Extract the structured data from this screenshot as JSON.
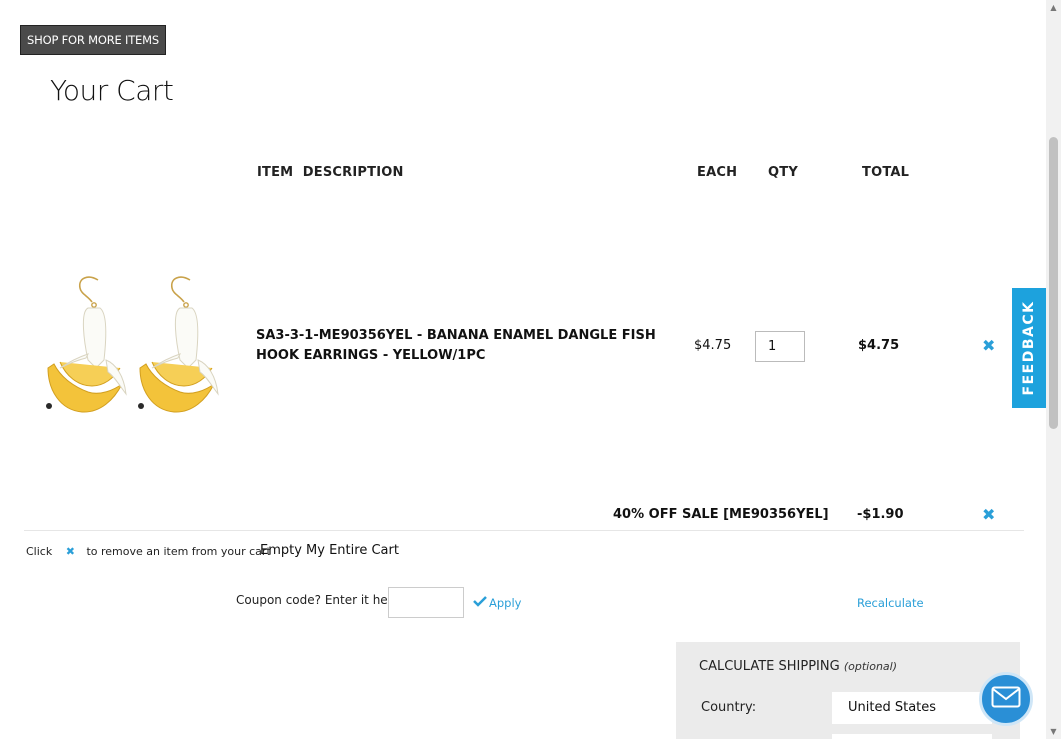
{
  "header": {
    "shop_button": "SHOP FOR MORE ITEMS",
    "page_title": "Your Cart"
  },
  "table": {
    "columns": [
      "ITEM  DESCRIPTION",
      "EACH",
      "QTY",
      "TOTAL"
    ]
  },
  "items": [
    {
      "image_name": "banana-earrings-image",
      "description": "SA3-3-1-ME90356YEL - BANANA ENAMEL DANGLE FISH HOOK EARRINGS - YELLOW/1PC",
      "each": "$4.75",
      "qty": "1",
      "total": "$4.75"
    }
  ],
  "discount": {
    "label": "40% OFF SALE [ME90356YEL]",
    "amount": "-$1.90"
  },
  "notes": {
    "click_prefix": "Click",
    "click_suffix": "to remove an item from your cart",
    "empty_cart": "Empty My Entire Cart"
  },
  "coupon": {
    "label": "Coupon code? Enter it here:",
    "value": "",
    "apply": "Apply",
    "recalculate": "Recalculate"
  },
  "shipping": {
    "title": "CALCULATE SHIPPING",
    "title_note": "(optional)",
    "country_label": "Country:",
    "country_value": "United States"
  },
  "feedback": {
    "label": "FEEDBACK"
  },
  "colors": {
    "accent": "#2a9fd8",
    "feedback": "#1da2dd",
    "button_dark": "#4a4a4a",
    "panel": "#ebebeb"
  },
  "icons": {
    "remove": "close-x-icon",
    "apply": "checkmark-icon",
    "chat": "envelope-icon"
  }
}
